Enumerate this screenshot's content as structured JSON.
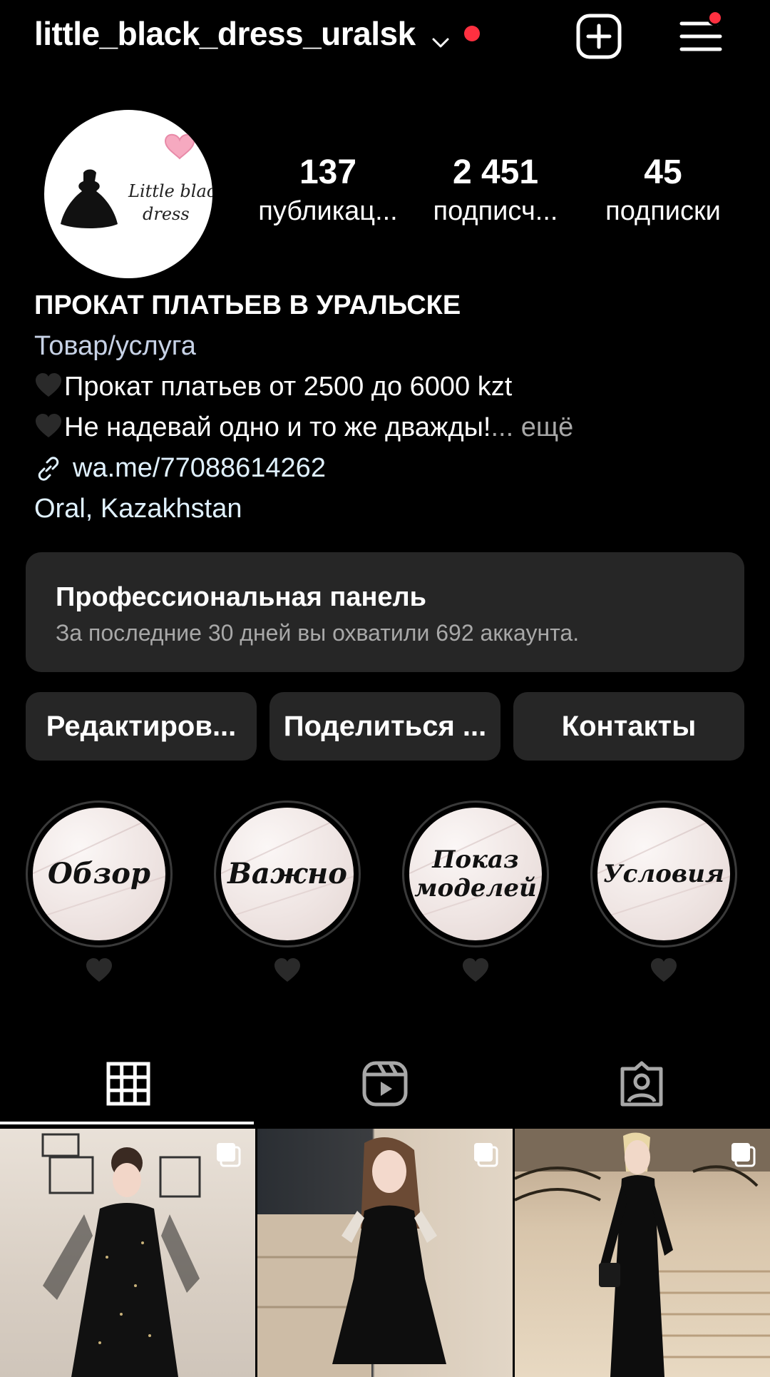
{
  "header": {
    "username": "little_black_dress_uralsk",
    "icons": [
      "chevron-down-icon",
      "new-post-icon",
      "menu-icon"
    ],
    "notification_color": "#ff3040"
  },
  "profile": {
    "avatar_text_line1": "Little black",
    "avatar_text_line2": "dress",
    "stats": [
      {
        "value": "137",
        "label": "публикац..."
      },
      {
        "value": "2 451",
        "label": "подписч..."
      },
      {
        "value": "45",
        "label": "подписки"
      }
    ]
  },
  "bio": {
    "name": "ПРОКАТ ПЛАТЬЕВ В УРАЛЬСКЕ",
    "category": "Товар/услуга",
    "line1": "Прокат платьев от 2500 до 6000 kzt",
    "line2": "Не надевай одно и то же дважды!",
    "more": "... ещё",
    "link": "wa.me/77088614262",
    "location": "Oral, Kazakhstan"
  },
  "pro_panel": {
    "title": "Профессиональная панель",
    "subtitle": "За последние 30 дней вы охватили 692 аккаунта."
  },
  "buttons": {
    "edit": "Редактиров...",
    "share": "Поделиться ...",
    "contacts": "Контакты"
  },
  "highlights": [
    {
      "title": "Обзор"
    },
    {
      "title": "Важно"
    },
    {
      "title_line1": "Показ",
      "title_line2": "моделей"
    },
    {
      "title": "Условия"
    }
  ],
  "tabs": [
    "grid-icon",
    "reels-icon",
    "tagged-icon"
  ]
}
